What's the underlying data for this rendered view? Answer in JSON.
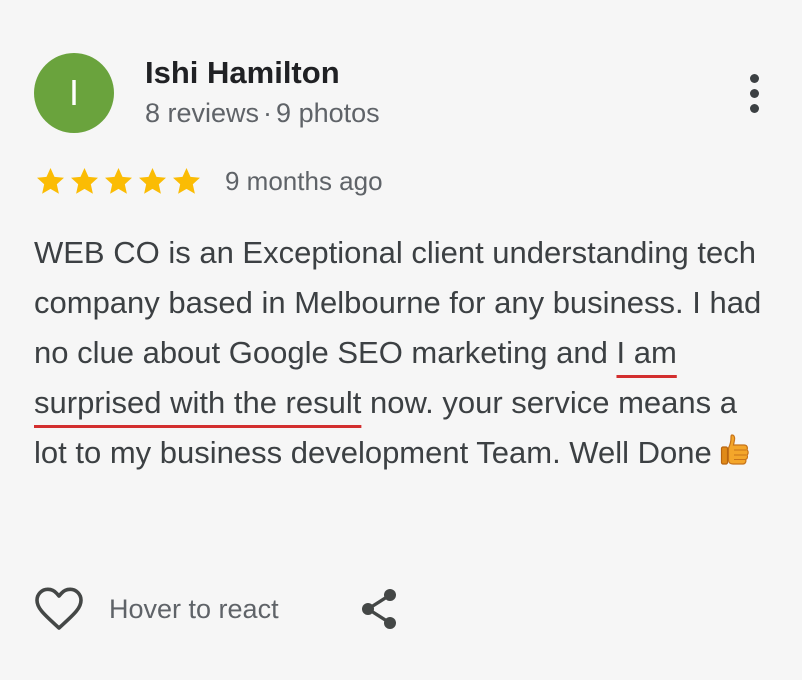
{
  "reviewer": {
    "initial": "I",
    "name": "Ishi Hamilton",
    "reviews": "8 reviews",
    "separator": "·",
    "photos": "9 photos",
    "avatar_color": "#6aa33d"
  },
  "rating": {
    "stars": 5,
    "max_stars": 5,
    "star_color": "#fbbc04",
    "time": "9 months ago"
  },
  "review": {
    "text_before": "WEB CO is an Exceptional client understanding tech company based in Melbourne for any business. I had no clue about Google SEO marketing and ",
    "highlight": "I am surprised with the result",
    "highlight_color": "#d32f2f",
    "text_after": " now. your service means a lot to my business development Team. Well Done",
    "emoji": "thumbs-up-emoji"
  },
  "actions": {
    "react_label": "Hover to react",
    "like_icon": "heart-icon",
    "share_icon": "share-icon",
    "more_icon": "more-vertical-icon"
  }
}
